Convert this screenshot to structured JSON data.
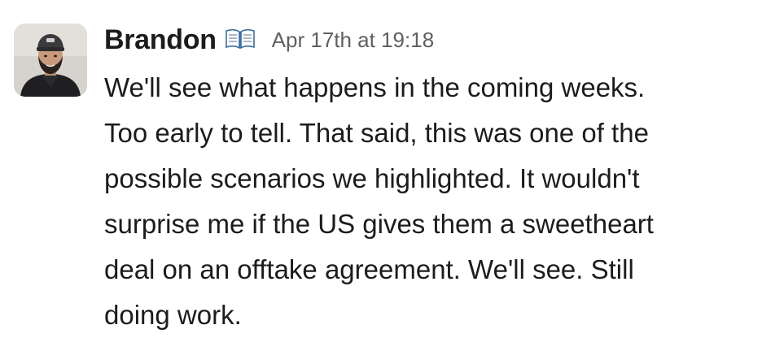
{
  "message": {
    "author": "Brandon",
    "status_icon": "open-book-icon",
    "timestamp": "Apr 17th at 19:18",
    "lines": [
      "We'll see what happens in the coming weeks.",
      "Too early to tell. That said, this was one of the",
      "possible scenarios we highlighted. It wouldn't",
      "surprise me if the US gives them a sweetheart",
      "deal on an offtake agreement. We'll see. Still",
      "doing work."
    ]
  },
  "colors": {
    "text": "#1d1c1d",
    "timestamp": "#616061",
    "background": "#ffffff"
  }
}
